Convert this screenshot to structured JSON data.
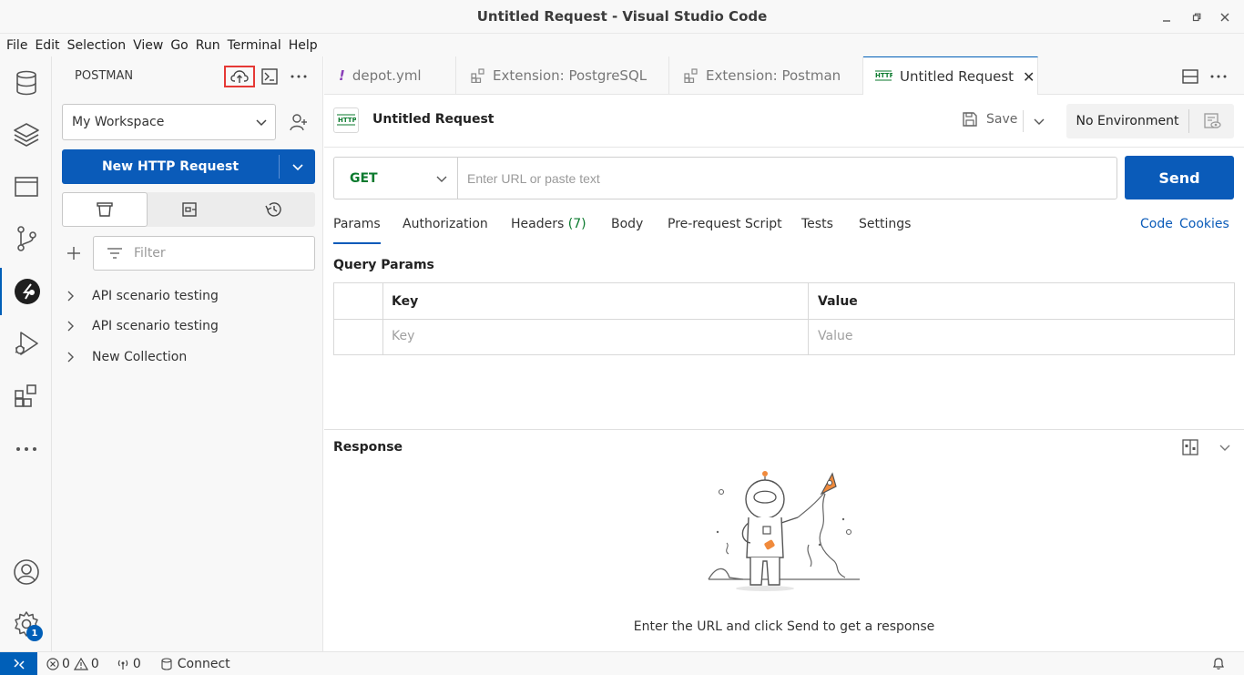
{
  "window": {
    "title": "Untitled Request - Visual Studio Code",
    "controls": [
      "minimize",
      "restore",
      "close"
    ]
  },
  "menu": [
    "File",
    "Edit",
    "Selection",
    "View",
    "Go",
    "Run",
    "Terminal",
    "Help"
  ],
  "activity_bar": {
    "items": [
      "database-icon",
      "layers-icon",
      "window-icon",
      "source-control-icon",
      "postman-icon",
      "run-debug-icon",
      "extensions-icon",
      "more-icon",
      "account-icon",
      "settings-icon"
    ],
    "active": "postman-icon",
    "settings_badge": "1"
  },
  "sidebar": {
    "title": "POSTMAN",
    "workspace": "My Workspace",
    "new_request_label": "New HTTP Request",
    "filter_placeholder": "Filter",
    "collections": [
      "API scenario testing",
      "API scenario testing",
      "New Collection"
    ]
  },
  "tabs": [
    {
      "label": "depot.yml",
      "icon": "exclamation-icon",
      "active": false
    },
    {
      "label": "Extension: PostgreSQL",
      "icon": "extension-icon",
      "active": false
    },
    {
      "label": "Extension: Postman",
      "icon": "extension-icon",
      "active": false
    },
    {
      "label": "Untitled Request",
      "icon": "http-icon",
      "active": true
    }
  ],
  "request": {
    "name": "Untitled Request",
    "save_label": "Save",
    "environment": "No Environment",
    "method": "GET",
    "url_placeholder": "Enter URL or paste text",
    "send_label": "Send",
    "tabs": {
      "params": "Params",
      "authorization": "Authorization",
      "headers": "Headers",
      "headers_count": "(7)",
      "body": "Body",
      "prerequest": "Pre-request Script",
      "tests": "Tests",
      "settings": "Settings"
    },
    "links": {
      "code": "Code",
      "cookies": "Cookies"
    },
    "query_params": {
      "title": "Query Params",
      "columns": [
        "Key",
        "Value"
      ],
      "placeholders": [
        "Key",
        "Value"
      ]
    }
  },
  "response": {
    "title": "Response",
    "empty_message": "Enter the URL and click Send to get a response"
  },
  "statusbar": {
    "errors": "0",
    "warnings": "0",
    "ports": "0",
    "connect_label": "Connect"
  },
  "colors": {
    "accent": "#005fb8",
    "button_blue": "#0a5bb9",
    "method_green": "#0b7a2e",
    "highlight_red": "#e53935",
    "rocket_orange": "#f08a3c"
  }
}
